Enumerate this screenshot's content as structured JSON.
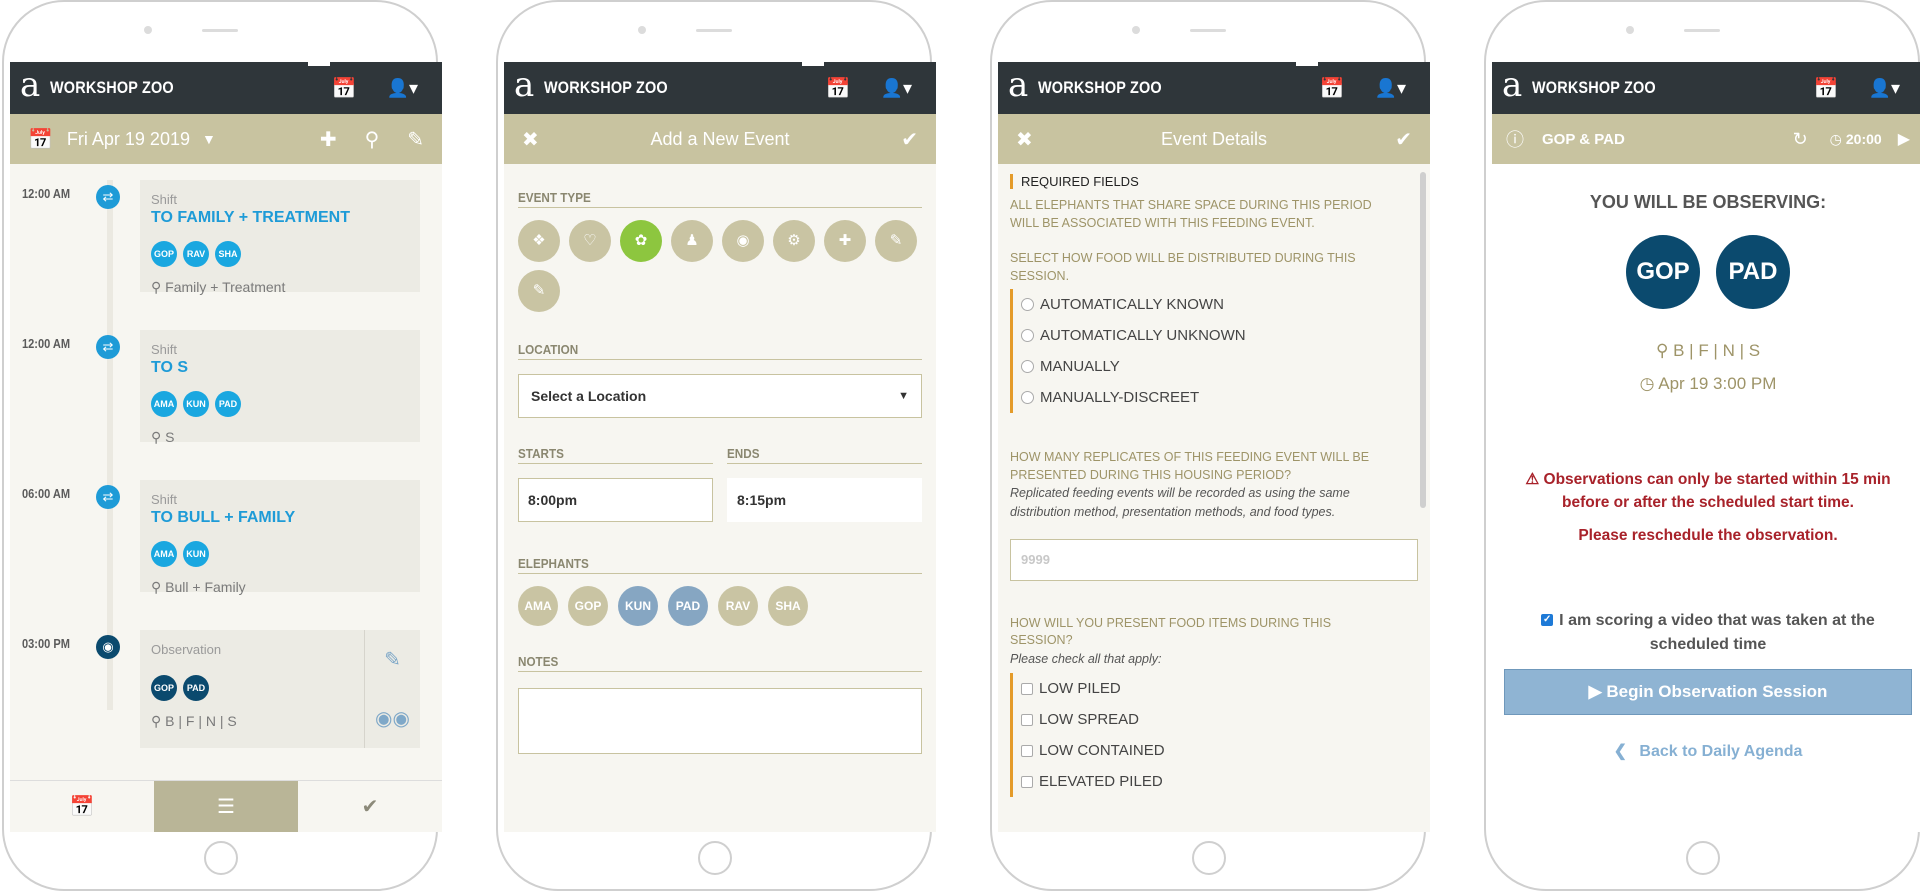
{
  "brand": "WORKSHOP ZOO",
  "logo": "a",
  "colors": {
    "topbar": "#2f363a",
    "subbar": "#c8c3a0",
    "accent_blue": "#1e9bd7",
    "dark_chip": "#0b4a6e",
    "warning": "#a8222a",
    "selected_type": "#8dc63f"
  },
  "agenda": {
    "date": "Fri Apr 19 2019",
    "events": [
      {
        "time": "12:00 AM",
        "kind": "Shift",
        "title": "TO FAMILY + TREATMENT",
        "chips": [
          "GOP",
          "RAV",
          "SHA"
        ],
        "location": "Family + Treatment"
      },
      {
        "time": "12:00 AM",
        "kind": "Shift",
        "title": "TO S",
        "chips": [
          "AMA",
          "KUN",
          "PAD"
        ],
        "location": "S"
      },
      {
        "time": "06:00 AM",
        "kind": "Shift",
        "title": "TO BULL + FAMILY",
        "chips": [
          "AMA",
          "KUN"
        ],
        "location": "Bull + Family"
      },
      {
        "time": "03:00 PM",
        "kind": "Observation",
        "chips": [
          "GOP",
          "PAD"
        ],
        "location": "B | F | N | S"
      }
    ]
  },
  "new_event": {
    "title": "Add a New Event",
    "event_type_label": "EVENT TYPE",
    "event_types": [
      "puzzle-icon",
      "heart-icon",
      "feeding-icon",
      "person-icon",
      "binoculars-icon",
      "gear-icon",
      "medical-kit-icon",
      "pencil-icon",
      "pencil-icon"
    ],
    "location_label": "LOCATION",
    "location_select": "Select a Location",
    "starts_label": "STARTS",
    "ends_label": "ENDS",
    "starts_value": "8:00pm",
    "ends_value": "8:15pm",
    "elephants_label": "ELEPHANTS",
    "elephants": [
      "AMA",
      "GOP",
      "KUN",
      "PAD",
      "RAV",
      "SHA"
    ],
    "notes_label": "NOTES"
  },
  "event_details": {
    "title": "Event Details",
    "required": "REQUIRED FIELDS",
    "intro": "ALL ELEPHANTS THAT SHARE SPACE DURING THIS PERIOD WILL BE ASSOCIATED WITH THIS FEEDING EVENT.",
    "q1": "SELECT HOW FOOD WILL BE DISTRIBUTED DURING THIS SESSION.",
    "q1_options": [
      "AUTOMATICALLY KNOWN",
      "AUTOMATICALLY UNKNOWN",
      "MANUALLY",
      "MANUALLY-DISCREET"
    ],
    "q2": "HOW MANY REPLICATES OF THIS FEEDING EVENT WILL BE PRESENTED DURING THIS HOUSING PERIOD?",
    "q2_help": "Replicated feeding events will be recorded as using the same distribution method, presentation methods, and food types.",
    "q2_placeholder": "9999",
    "q3": "HOW WILL YOU PRESENT FOOD ITEMS DURING THIS SESSION?",
    "q3_help": "Please check all that apply:",
    "q3_options": [
      "LOW PILED",
      "LOW SPREAD",
      "LOW CONTAINED",
      "ELEVATED PILED"
    ]
  },
  "observation": {
    "header": "GOP & PAD",
    "timer": "20:00",
    "title": "YOU WILL BE OBSERVING:",
    "chips": [
      "GOP",
      "PAD"
    ],
    "location": "B | F | N | S",
    "datetime": "Apr 19 3:00 PM",
    "warning": "Observations can only be started within 15 min before or after the scheduled start time.",
    "reschedule": "Please reschedule the observation.",
    "checkbox": "I am scoring a video that was taken at the scheduled time",
    "begin": "Begin Observation Session",
    "back": "Back to Daily Agenda"
  }
}
